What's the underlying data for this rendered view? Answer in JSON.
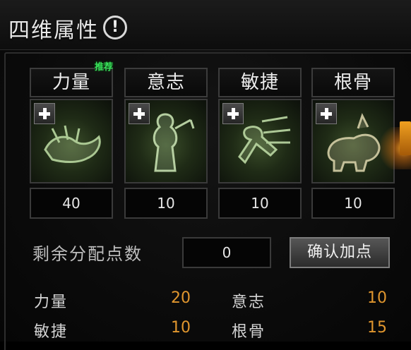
{
  "title": "四维属性",
  "help_icon_glyph": "!",
  "recommend_badge": "推荐",
  "stats": [
    {
      "label": "力量",
      "value": "40",
      "icon": "strength-icon"
    },
    {
      "label": "意志",
      "value": "10",
      "icon": "will-icon"
    },
    {
      "label": "敏捷",
      "value": "10",
      "icon": "agility-icon"
    },
    {
      "label": "根骨",
      "value": "10",
      "icon": "constitution-icon"
    }
  ],
  "remaining": {
    "label": "剩余分配点数",
    "value": "0"
  },
  "confirm_button": "确认加点",
  "summary": [
    {
      "label": "力量",
      "value": "20"
    },
    {
      "label": "意志",
      "value": "10"
    },
    {
      "label": "敏捷",
      "value": "10"
    },
    {
      "label": "根骨",
      "value": "15"
    }
  ],
  "colors": {
    "summary_value": "#e0962e",
    "recommend": "#38e05a",
    "art_glow": "#3b4e2a"
  }
}
